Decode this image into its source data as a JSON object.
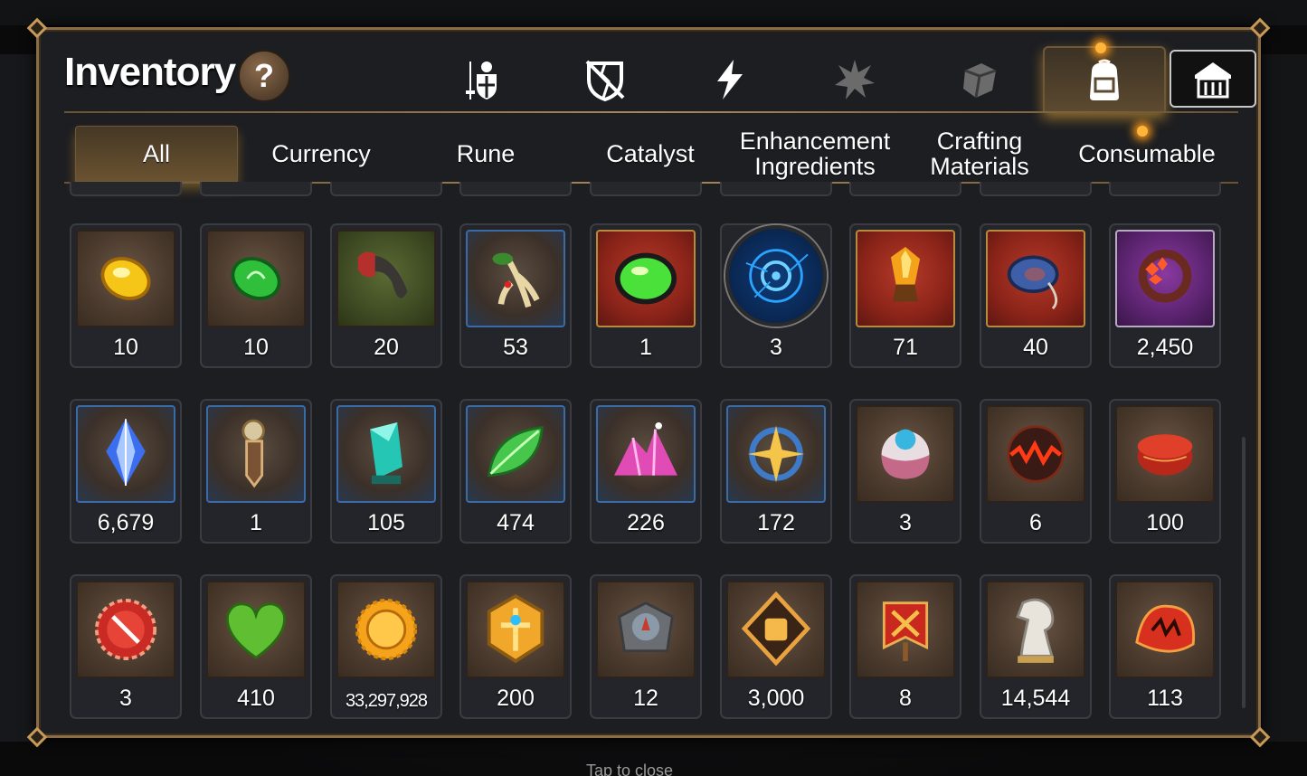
{
  "panel": {
    "title": "Inventory",
    "help_label": "?"
  },
  "category_tabs": [
    {
      "icon": "weapon-armor-icon",
      "active": false
    },
    {
      "icon": "broken-shield-icon",
      "active": false
    },
    {
      "icon": "lightning-icon",
      "active": false
    },
    {
      "icon": "splinter-star-icon",
      "active": false
    },
    {
      "icon": "cube-icon",
      "active": false
    },
    {
      "icon": "backpack-icon",
      "active": true
    },
    {
      "icon": "storehouse-icon",
      "active": false
    }
  ],
  "subtabs": [
    {
      "label": "All",
      "active": true
    },
    {
      "label": "Currency",
      "active": false
    },
    {
      "label": "Rune",
      "active": false
    },
    {
      "label": "Catalyst",
      "active": false
    },
    {
      "label": "Enhancement Ingredients",
      "active": false
    },
    {
      "label": "Crafting Materials",
      "active": false
    },
    {
      "label": "Consumable",
      "active": false
    }
  ],
  "items": [
    {
      "icon": "gold-gem-icon",
      "count": "10",
      "frame": "plain"
    },
    {
      "icon": "green-gem-icon",
      "count": "10",
      "frame": "plain"
    },
    {
      "icon": "claw-icon",
      "count": "20",
      "frame": "green"
    },
    {
      "icon": "root-herb-icon",
      "count": "53",
      "frame": "blue"
    },
    {
      "icon": "green-orb-icon",
      "count": "1",
      "frame": "red"
    },
    {
      "icon": "blue-rune-disc-icon",
      "count": "3",
      "frame": "round"
    },
    {
      "icon": "fire-crystal-icon",
      "count": "71",
      "frame": "red"
    },
    {
      "icon": "blue-ring-icon",
      "count": "40",
      "frame": "red"
    },
    {
      "icon": "red-bangle-icon",
      "count": "2,450",
      "frame": "purple"
    },
    {
      "icon": "blue-crystal-icon",
      "count": "6,679",
      "frame": "blue"
    },
    {
      "icon": "bookmark-key-icon",
      "count": "1",
      "frame": "blue"
    },
    {
      "icon": "teal-crystal-icon",
      "count": "105",
      "frame": "blue"
    },
    {
      "icon": "green-leaf-icon",
      "count": "474",
      "frame": "blue"
    },
    {
      "icon": "pink-crystal-pile-icon",
      "count": "226",
      "frame": "blue"
    },
    {
      "icon": "star-amulet-icon",
      "count": "172",
      "frame": "blue"
    },
    {
      "icon": "pet-ball-icon",
      "count": "3",
      "frame": "plain"
    },
    {
      "icon": "lava-orb-icon",
      "count": "6",
      "frame": "plain"
    },
    {
      "icon": "red-ring-icon",
      "count": "100",
      "frame": "plain"
    },
    {
      "icon": "red-badge-icon",
      "count": "3",
      "frame": "plain"
    },
    {
      "icon": "green-heart-icon",
      "count": "410",
      "frame": "plain"
    },
    {
      "icon": "gold-coin-icon",
      "count": "33,297,928",
      "frame": "plain"
    },
    {
      "icon": "gold-emblem-icon",
      "count": "200",
      "frame": "plain"
    },
    {
      "icon": "stone-compass-icon",
      "count": "12",
      "frame": "plain"
    },
    {
      "icon": "fist-emblem-icon",
      "count": "3,000",
      "frame": "plain"
    },
    {
      "icon": "war-banner-icon",
      "count": "8",
      "frame": "plain"
    },
    {
      "icon": "chess-knight-icon",
      "count": "14,544",
      "frame": "plain"
    },
    {
      "icon": "red-leaf-icon",
      "count": "113",
      "frame": "plain"
    }
  ],
  "background": {
    "hint": "Tap to close"
  },
  "colors": {
    "frame_gold": "#8a6c46",
    "active_glow": "#ffb43a"
  }
}
